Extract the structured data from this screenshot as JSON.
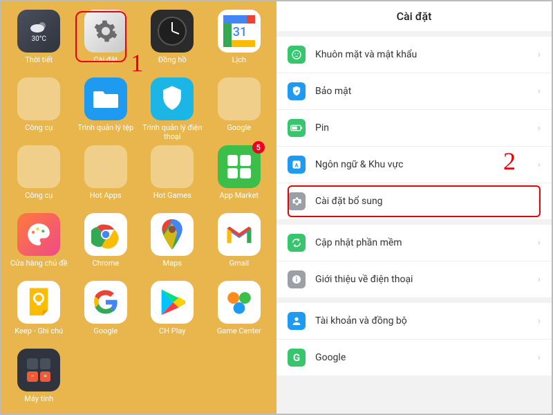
{
  "home": {
    "apps": [
      {
        "id": "weather",
        "label": "Thời tiết",
        "temp": "30°C"
      },
      {
        "id": "settings",
        "label": "Cài đặt"
      },
      {
        "id": "clock",
        "label": "Đồng hồ"
      },
      {
        "id": "calendar",
        "label": "Lịch",
        "day": "31"
      },
      {
        "id": "tools1",
        "label": "Công cụ"
      },
      {
        "id": "files",
        "label": "Trình quản lý tệp"
      },
      {
        "id": "phonemanager",
        "label": "Trình quản lý điện thoại"
      },
      {
        "id": "google-folder",
        "label": "Google"
      },
      {
        "id": "tools2",
        "label": "Công cụ"
      },
      {
        "id": "hotapps",
        "label": "Hot Apps"
      },
      {
        "id": "hotgames",
        "label": "Hot Games"
      },
      {
        "id": "appmarket",
        "label": "App Market",
        "badge": "5"
      },
      {
        "id": "themestore",
        "label": "Cửa hàng chủ đề"
      },
      {
        "id": "chrome",
        "label": "Chrome"
      },
      {
        "id": "maps",
        "label": "Maps"
      },
      {
        "id": "gmail",
        "label": "Gmail"
      },
      {
        "id": "keep",
        "label": "Keep - Ghi chú"
      },
      {
        "id": "google",
        "label": "Google"
      },
      {
        "id": "chplay",
        "label": "CH Play"
      },
      {
        "id": "gamecenter",
        "label": "Game Center"
      },
      {
        "id": "calculator",
        "label": "Máy tính"
      }
    ]
  },
  "settings": {
    "title": "Cài đặt",
    "groups": [
      [
        {
          "id": "face",
          "label": "Khuôn mặt và mật khẩu",
          "color": "#37c66e"
        },
        {
          "id": "security",
          "label": "Bảo mật",
          "color": "#1e9bf0"
        },
        {
          "id": "battery",
          "label": "Pin",
          "color": "#37c66e"
        },
        {
          "id": "language",
          "label": "Ngôn ngữ & Khu vực",
          "color": "#1e9bf0"
        },
        {
          "id": "additional",
          "label": "Cài đặt bổ sung",
          "color": "#9aa0a6"
        }
      ],
      [
        {
          "id": "update",
          "label": "Cập nhật phần mềm",
          "color": "#37c66e"
        },
        {
          "id": "about",
          "label": "Giới thiệu về điện thoại",
          "color": "#9aa0a6"
        }
      ],
      [
        {
          "id": "accounts",
          "label": "Tài khoản và đồng bộ",
          "color": "#1e9bf0"
        },
        {
          "id": "google-setting",
          "label": "Google",
          "color": "#37c66e"
        }
      ]
    ]
  },
  "annotations": {
    "step1": "1",
    "step2": "2"
  }
}
